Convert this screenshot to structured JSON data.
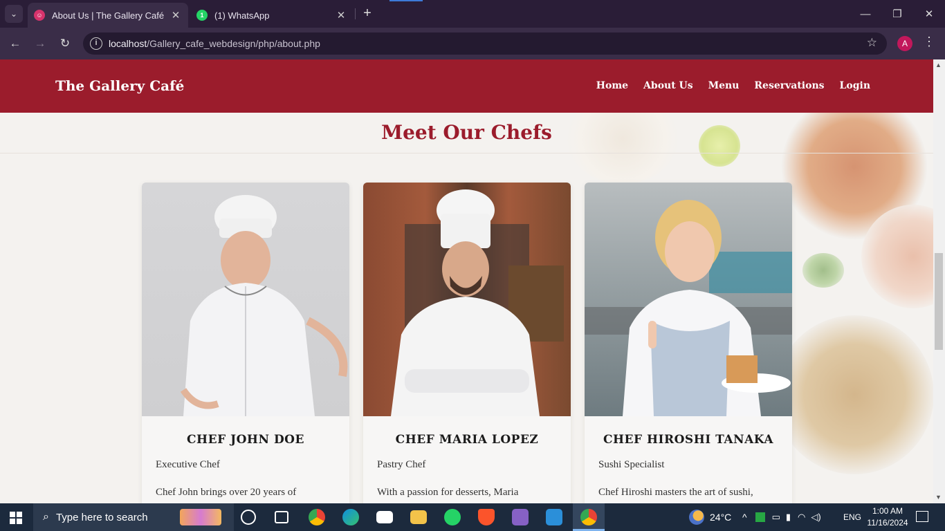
{
  "browser": {
    "tabs": [
      {
        "title": "About Us | The Gallery Café",
        "icon": "gallery-cafe-favicon",
        "active": true
      },
      {
        "title": "(1) WhatsApp",
        "icon": "whatsapp-favicon",
        "active": false
      }
    ],
    "url_host": "localhost",
    "url_path": "/Gallery_cafe_webdesign/php/about.php",
    "profile_initial": "A"
  },
  "site": {
    "brand": "The Gallery Café",
    "nav": [
      "Home",
      "About Us",
      "Menu",
      "Reservations",
      "Login"
    ],
    "colors": {
      "primary": "#9b1c2c"
    }
  },
  "section": {
    "title": "Meet Our Chefs",
    "chefs": [
      {
        "name": "CHEF JOHN DOE",
        "role": "Executive Chef",
        "bio": "Chef John brings over 20 years of"
      },
      {
        "name": "CHEF MARIA LOPEZ",
        "role": "Pastry Chef",
        "bio": "With a passion for desserts, Maria"
      },
      {
        "name": "CHEF HIROSHI TANAKA",
        "role": "Sushi Specialist",
        "bio": "Chef Hiroshi masters the art of sushi,"
      }
    ]
  },
  "taskbar": {
    "search_placeholder": "Type here to search",
    "weather": "24°C",
    "language": "ENG",
    "time": "1:00 AM",
    "date": "11/16/2024"
  }
}
